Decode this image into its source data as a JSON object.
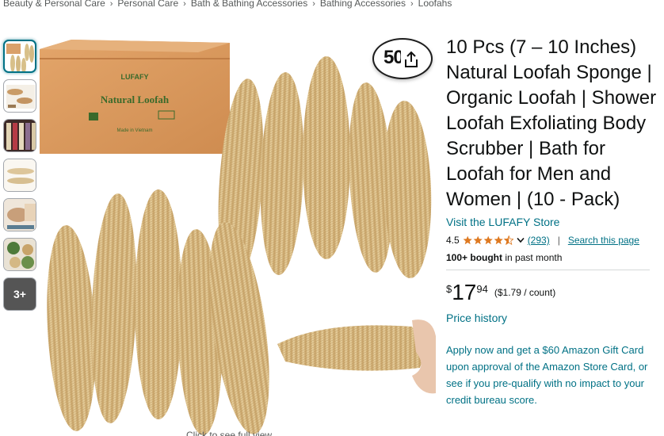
{
  "breadcrumb": {
    "items": [
      "Beauty & Personal Care",
      "Personal Care",
      "Bath & Bathing Accessories",
      "Bathing Accessories",
      "Loofahs"
    ],
    "separator": "›"
  },
  "gallery": {
    "thumbnail_count": 7,
    "selected_index": 0,
    "more_label": "3+",
    "share_count": "50",
    "share_icon": "share-icon",
    "box": {
      "brand": "LUFAFY",
      "product": "Natural Loofah",
      "made_in": "Made in Vietnam"
    },
    "caption": "Click to see full view"
  },
  "product": {
    "title": "10 Pcs (7 – 10 Inches) Natural Loofah Sponge | Organic Loofah | Shower Loofah Exfoliating Body Scrubber | Bath for Loofah for Men and Women | (10 - Pack)",
    "store_link": "Visit the LUFAFY Store",
    "rating": {
      "value": "4.5",
      "stars": 4.5,
      "count": "(293)",
      "separator": "|",
      "search_link": "Search this page"
    },
    "bought": {
      "bold": "100+ bought",
      "rest": " in past month"
    },
    "price": {
      "symbol": "$",
      "whole": "17",
      "fraction": "94",
      "unit": "($1.79 / count)"
    },
    "price_history": "Price history",
    "promo": "Apply now and get a $60 Amazon Gift Card upon approval of the Amazon Store Card, or see if you pre-qualify with no impact to your credit bureau score."
  },
  "colors": {
    "link": "#007185",
    "star": "#de7921",
    "text": "#0f1111",
    "muted": "#565959"
  }
}
